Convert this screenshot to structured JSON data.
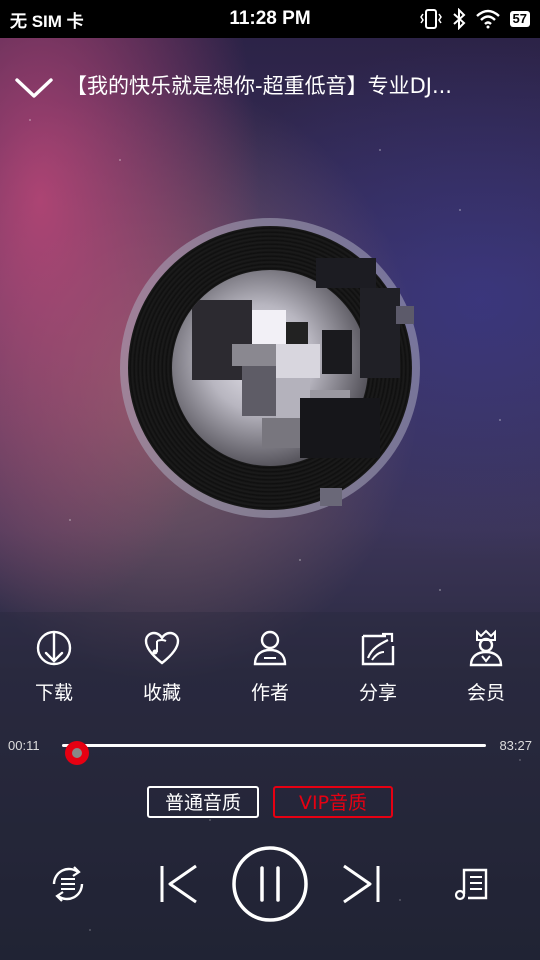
{
  "status_bar": {
    "carrier": "无 SIM 卡",
    "time": "11:28 PM",
    "battery": "57"
  },
  "header": {
    "title": "【我的快乐就是想你-超重低音】专业DJ..."
  },
  "actions": [
    {
      "label": "下载",
      "icon": "download-icon"
    },
    {
      "label": "收藏",
      "icon": "favorite-icon"
    },
    {
      "label": "作者",
      "icon": "author-icon"
    },
    {
      "label": "分享",
      "icon": "share-icon"
    },
    {
      "label": "会员",
      "icon": "vip-member-icon"
    }
  ],
  "progress": {
    "current": "00:11",
    "total": "83:27",
    "fraction": 0.002
  },
  "quality": {
    "normal": "普通音质",
    "vip": "VIP音质"
  },
  "colors": {
    "accent": "#e60012",
    "text": "#ffffff"
  },
  "playback": {
    "state": "playing",
    "icons": [
      "loop-mode-icon",
      "previous-icon",
      "pause-icon",
      "next-icon",
      "playlist-icon"
    ]
  }
}
